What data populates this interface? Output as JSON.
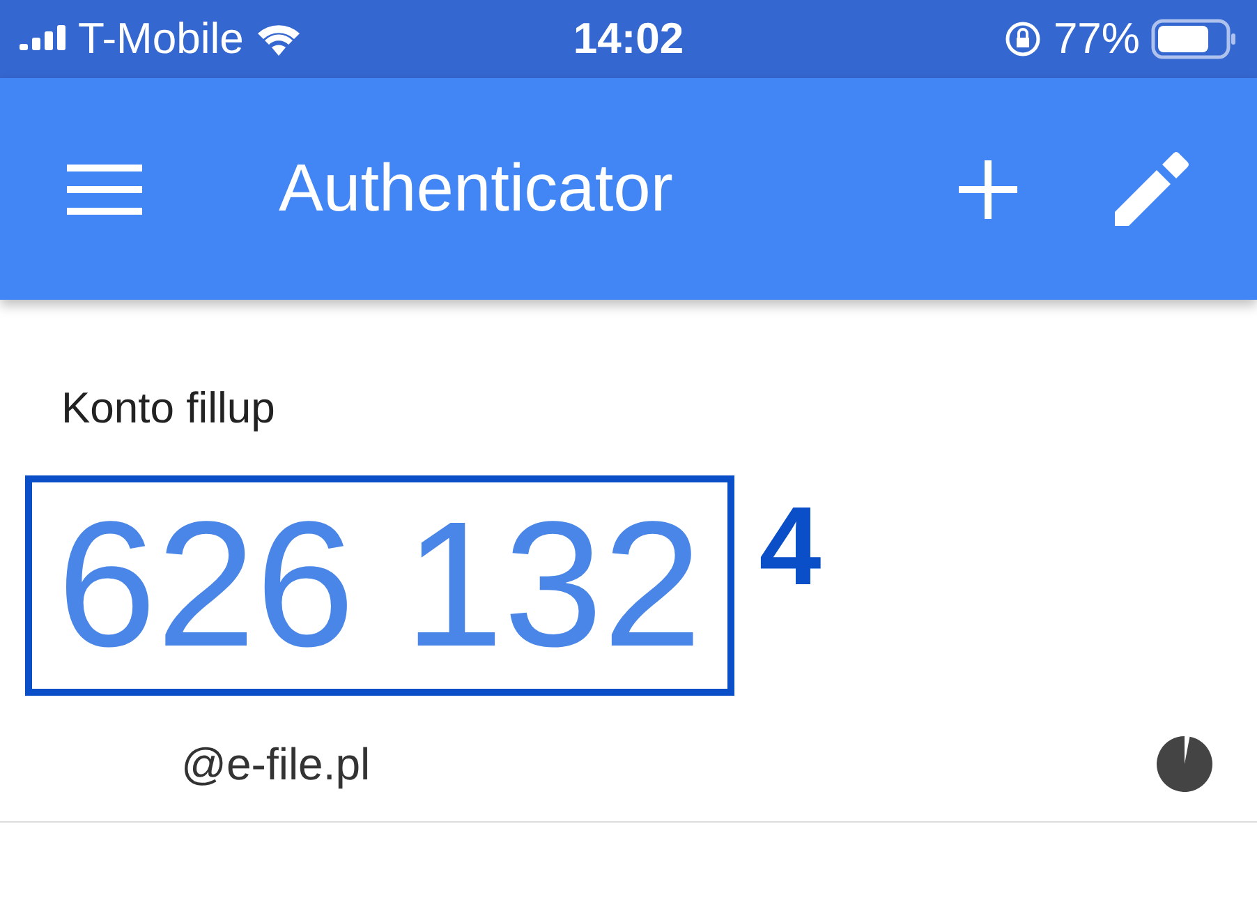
{
  "status_bar": {
    "carrier": "T-Mobile",
    "time": "14:02",
    "battery": "77%"
  },
  "app_bar": {
    "title": "Authenticator"
  },
  "account": {
    "name": "Konto fillup",
    "code": "626 132",
    "highlighted": true,
    "annotation": "4",
    "email": "@e-file.pl",
    "timer": {
      "level": 0.97
    }
  }
}
